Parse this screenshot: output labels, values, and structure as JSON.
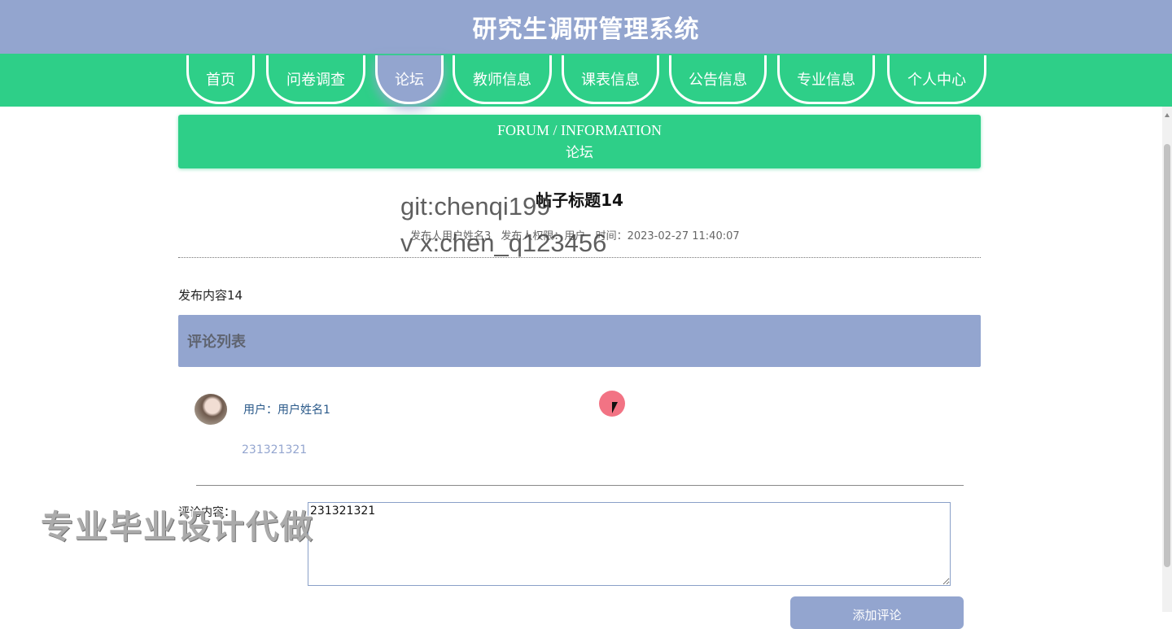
{
  "app": {
    "title": "研究生调研管理系统"
  },
  "nav": {
    "items": [
      {
        "label": "首页"
      },
      {
        "label": "问卷调查"
      },
      {
        "label": "论坛",
        "active": true
      },
      {
        "label": "教师信息"
      },
      {
        "label": "课表信息"
      },
      {
        "label": "公告信息"
      },
      {
        "label": "专业信息"
      },
      {
        "label": "个人中心"
      }
    ]
  },
  "banner": {
    "en": "FORUM / INFORMATION",
    "cn": "论坛"
  },
  "post": {
    "title": "帖子标题14",
    "meta": {
      "author": "发布人用户姓名3",
      "role": "发布人权限：用户",
      "time": "时间：2023-02-27 11:40:07"
    },
    "content": "发布内容14"
  },
  "comments": {
    "header": "评论列表",
    "items": [
      {
        "user": "用户：用户姓名1",
        "text": "231321321"
      }
    ]
  },
  "form": {
    "label": "评论内容：",
    "value": "231321321",
    "submit_label": "添加评论"
  },
  "watermarks": {
    "git": "git:chenqi199",
    "vx": "v x:chen_q123456",
    "bottom": "专业毕业设计代做"
  },
  "colors": {
    "primary_green": "#2ecf88",
    "accent_blue": "#93a5cf"
  }
}
